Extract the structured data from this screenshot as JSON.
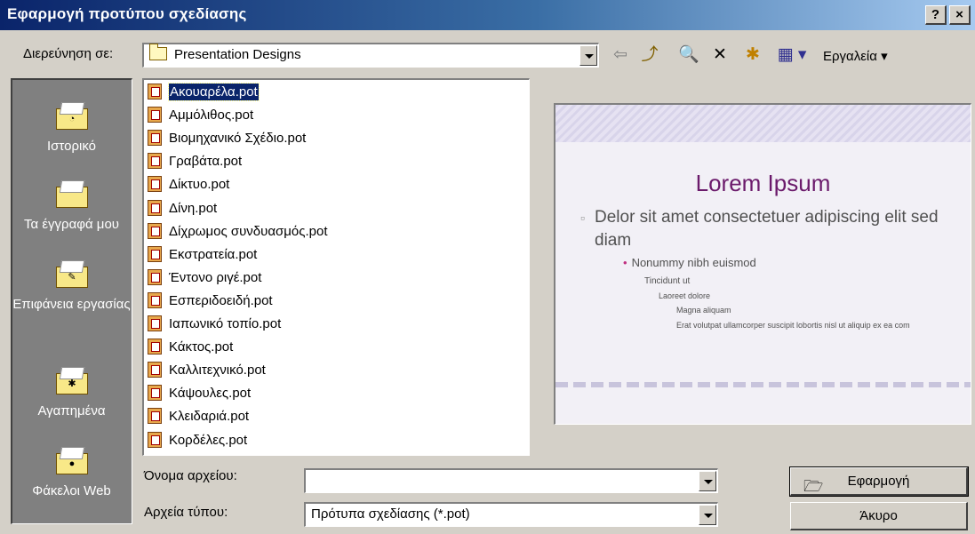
{
  "window": {
    "title": "Εφαρμογή προτύπου σχεδίασης",
    "help_label": "?",
    "close_label": "×"
  },
  "lookin": {
    "label": "Διερεύνηση σε:",
    "value": "Presentation Designs"
  },
  "toolbar": {
    "back_glyph": "⇦",
    "up_glyph": "⤴",
    "search_glyph": "🔍",
    "delete_glyph": "✕",
    "new_folder_glyph": "✱",
    "views_glyph": "▦ ▾",
    "tools_label": "Εργαλεία",
    "tools_arrow": "▾"
  },
  "places": [
    {
      "label": "Ιστορικό",
      "icon": "history-icon",
      "emblem": "◔"
    },
    {
      "label": "Τα έγγραφά μου",
      "icon": "my-documents-icon",
      "emblem": ""
    },
    {
      "label": "Επιφάνεια εργασίας",
      "icon": "desktop-icon",
      "emblem": "✎"
    },
    {
      "label": "Αγαπημένα",
      "icon": "favorites-icon",
      "emblem": "✱"
    },
    {
      "label": "Φάκελοι Web",
      "icon": "web-folders-icon",
      "emblem": "●"
    }
  ],
  "files": [
    "Ακουαρέλα.pot",
    "Αμμόλιθος.pot",
    "Βιομηχανικό Σχέδιο.pot",
    "Γραβάτα.pot",
    "Δίκτυο.pot",
    "Δίνη.pot",
    "Δίχρωμος συνδυασμός.pot",
    "Εκστρατεία.pot",
    "Έντονο ριγέ.pot",
    "Εσπεριδοειδή.pot",
    "Ιαπωνικό τοπίο.pot",
    "Κάκτος.pot",
    "Καλλιτεχνικό.pot",
    "Κάψουλες.pot",
    "Κλειδαριά.pot",
    "Κορδέλες.pot"
  ],
  "selected_index": 0,
  "preview": {
    "title": "Lorem Ipsum",
    "bullet1": "Delor sit amet consectetuer adipiscing elit sed diam",
    "bullet2": "Nonummy nibh euismod",
    "bullet3": "Tincidunt ut",
    "bullet4": "Laoreet dolore",
    "bullet5": "Magna aliquam",
    "bullet6": "Erat volutpat ullamcorper suscipit lobortis nisl ut aliquip ex ea com"
  },
  "filename": {
    "label": "Όνομα αρχείου:",
    "value": ""
  },
  "filetype": {
    "label": "Αρχεία τύπου:",
    "value": "Πρότυπα σχεδίασης (*.pot)"
  },
  "buttons": {
    "apply": "Εφαρμογή",
    "apply_icon": "open-folder-icon",
    "cancel": "Άκυρο"
  }
}
